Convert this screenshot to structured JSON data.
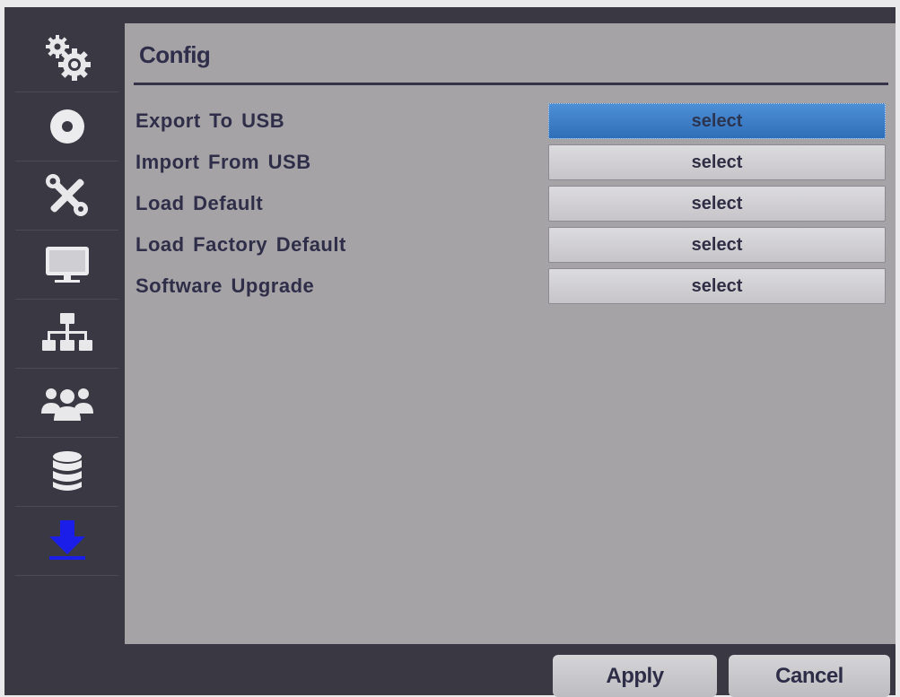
{
  "header": {
    "title": "Config"
  },
  "sidebar": {
    "items": [
      {
        "icon": "gears-icon"
      },
      {
        "icon": "disc-icon"
      },
      {
        "icon": "tools-icon"
      },
      {
        "icon": "monitor-icon"
      },
      {
        "icon": "network-icon"
      },
      {
        "icon": "users-icon"
      },
      {
        "icon": "database-icon"
      },
      {
        "icon": "download-icon",
        "selected": true
      }
    ]
  },
  "rows": [
    {
      "label": "Export To USB",
      "button": "select"
    },
    {
      "label": "Import From USB",
      "button": "select"
    },
    {
      "label": "Load Default",
      "button": "select"
    },
    {
      "label": "Load Factory Default",
      "button": "select"
    },
    {
      "label": "Software Upgrade",
      "button": "select"
    }
  ],
  "footer": {
    "apply_label": "Apply",
    "cancel_label": "Cancel"
  },
  "colors": {
    "background": "#3a3842",
    "panel": "#a6a3a7",
    "text": "#2f2e49",
    "highlight": "#2f6fb9",
    "selected_icon": "#1a1ee8"
  }
}
